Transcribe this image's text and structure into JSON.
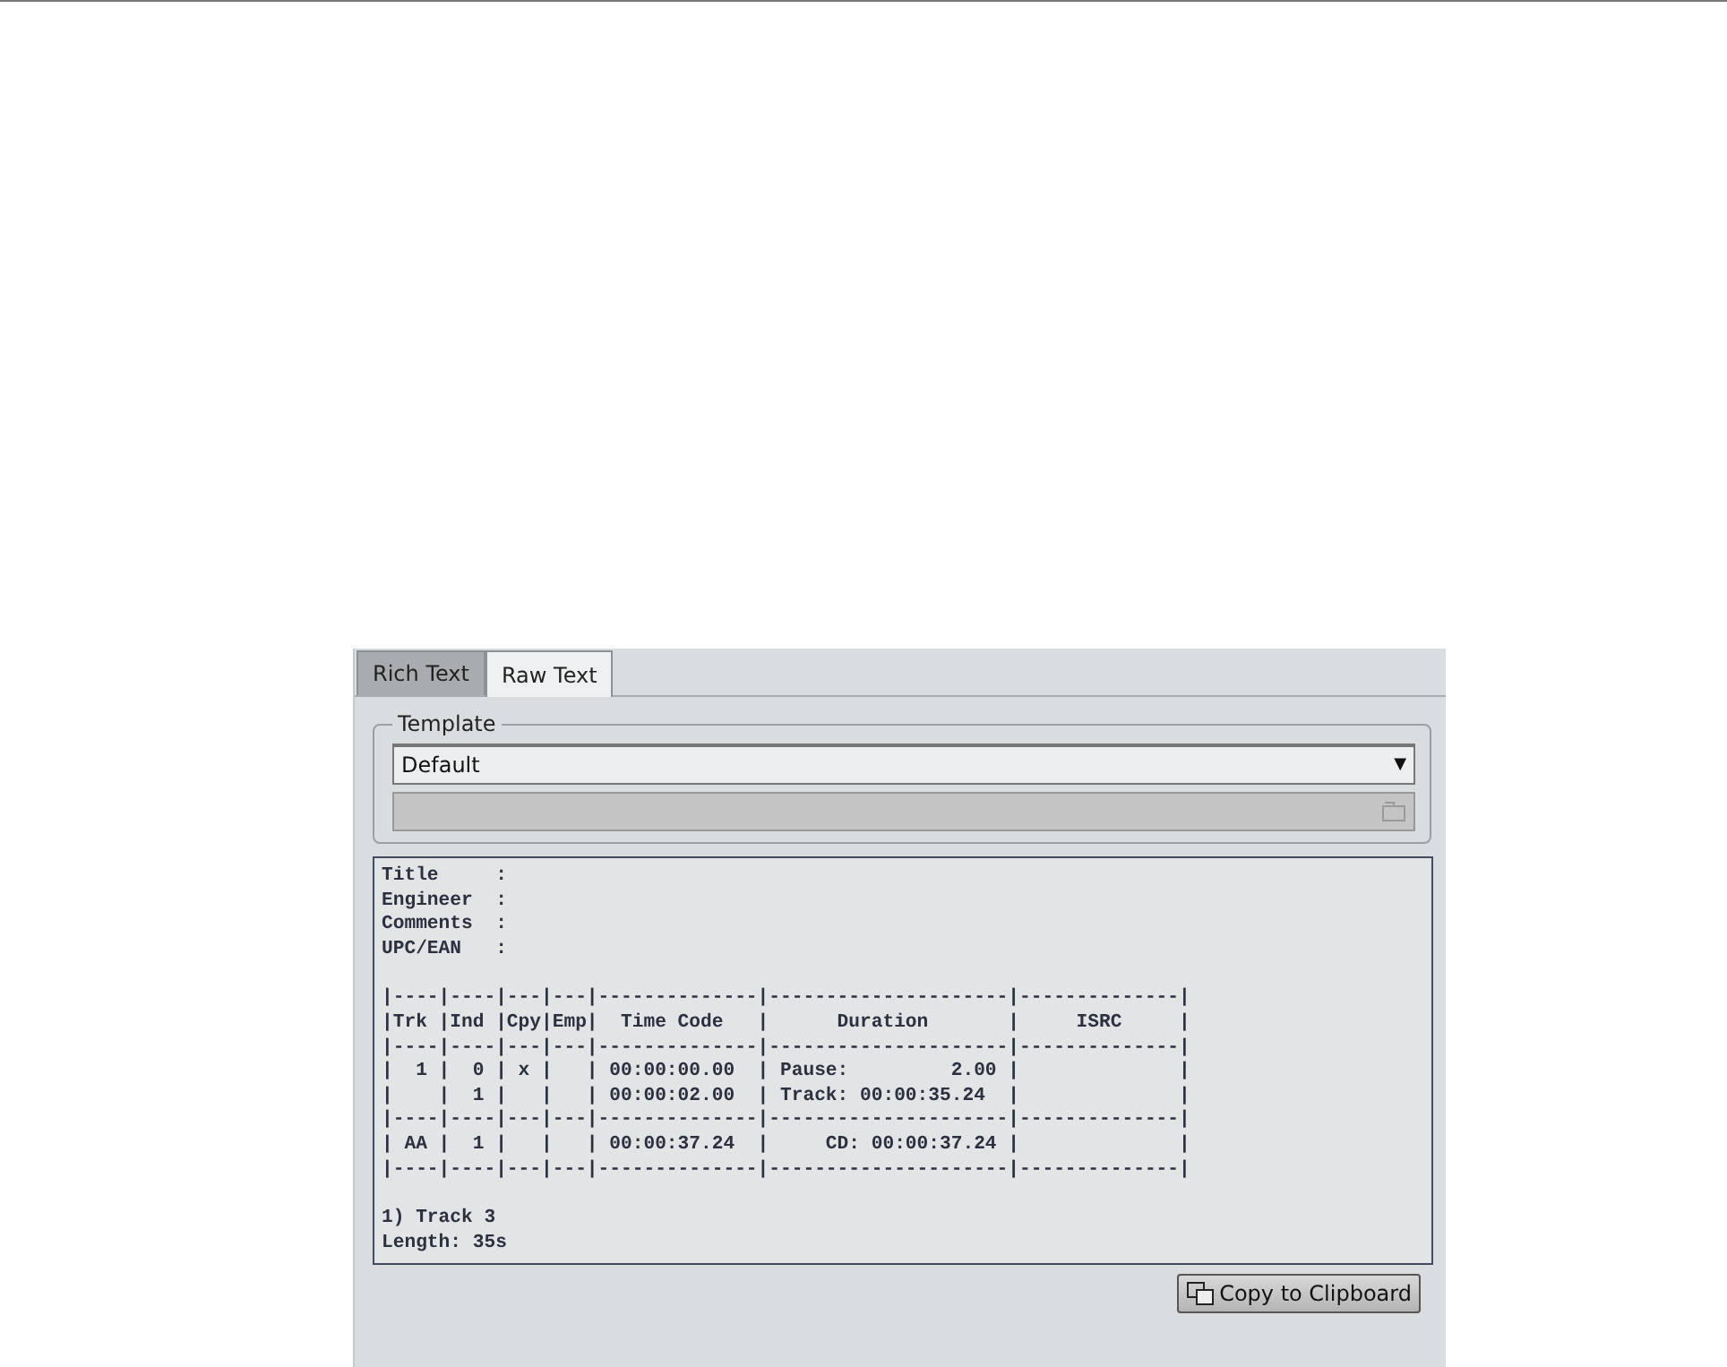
{
  "tabs": [
    {
      "label": "Rich Text",
      "selected": false
    },
    {
      "label": "Raw Text",
      "selected": true
    }
  ],
  "template": {
    "legend": "Template",
    "dropdown": "Default",
    "dropdown_arrow": "▼"
  },
  "raw_text": {
    "header_lines": [
      "Title     :",
      "Engineer  :",
      "Comments  :",
      "UPC/EAN   :"
    ],
    "table_lines": [
      "|----|----|---|---|--------------|---------------------|--------------|",
      "|Trk |Ind |Cpy|Emp|  Time Code   |      Duration       |     ISRC     |",
      "|----|----|---|---|--------------|---------------------|--------------|",
      "|  1 |  0 | x |   | 00:00:00.00  | Pause:         2.00 |              |",
      "|    |  1 |   |   | 00:00:02.00  | Track: 00:00:35.24  |              |",
      "|----|----|---|---|--------------|---------------------|--------------|",
      "| AA |  1 |   |   | 00:00:37.24  |     CD: 00:00:37.24 |              |",
      "|----|----|---|---|--------------|---------------------|--------------|"
    ],
    "footer_lines": [
      "1) Track 3",
      "Length: 35s"
    ]
  },
  "copy_button": "Copy to Clipboard"
}
